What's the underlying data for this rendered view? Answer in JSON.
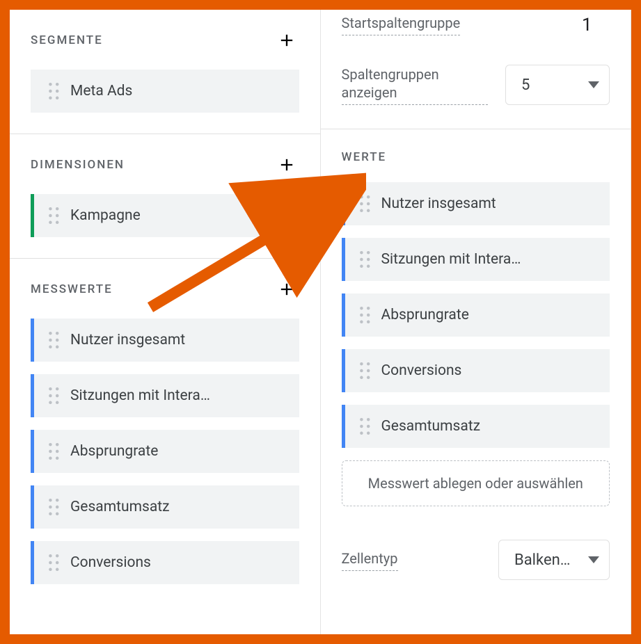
{
  "left": {
    "segments": {
      "title": "SEGMENTE",
      "items": [
        {
          "label": "Meta Ads",
          "accent": "none"
        }
      ]
    },
    "dimensions": {
      "title": "DIMENSIONEN",
      "items": [
        {
          "label": "Kampagne",
          "accent": "green"
        }
      ]
    },
    "metrics": {
      "title": "MESSWERTE",
      "items": [
        {
          "label": "Nutzer insgesamt",
          "accent": "blue"
        },
        {
          "label": "Sitzungen mit Intera…",
          "accent": "blue"
        },
        {
          "label": "Absprungrate",
          "accent": "blue"
        },
        {
          "label": "Gesamtumsatz",
          "accent": "blue"
        },
        {
          "label": "Conversions",
          "accent": "blue"
        }
      ]
    }
  },
  "right": {
    "start_col_group_label": "Startspaltengruppe",
    "start_col_group_value": "1",
    "show_col_groups_label": "Spaltengruppen anzeigen",
    "show_col_groups_value": "5",
    "values": {
      "title": "WERTE",
      "items": [
        {
          "label": "Nutzer insgesamt",
          "accent": "blue"
        },
        {
          "label": "Sitzungen mit Intera…",
          "accent": "blue"
        },
        {
          "label": "Absprungrate",
          "accent": "blue"
        },
        {
          "label": "Conversions",
          "accent": "blue"
        },
        {
          "label": "Gesamtumsatz",
          "accent": "blue"
        }
      ],
      "dropzone": "Messwert ablegen oder auswählen"
    },
    "cell_type_label": "Zellentyp",
    "cell_type_value": "Balken…"
  }
}
